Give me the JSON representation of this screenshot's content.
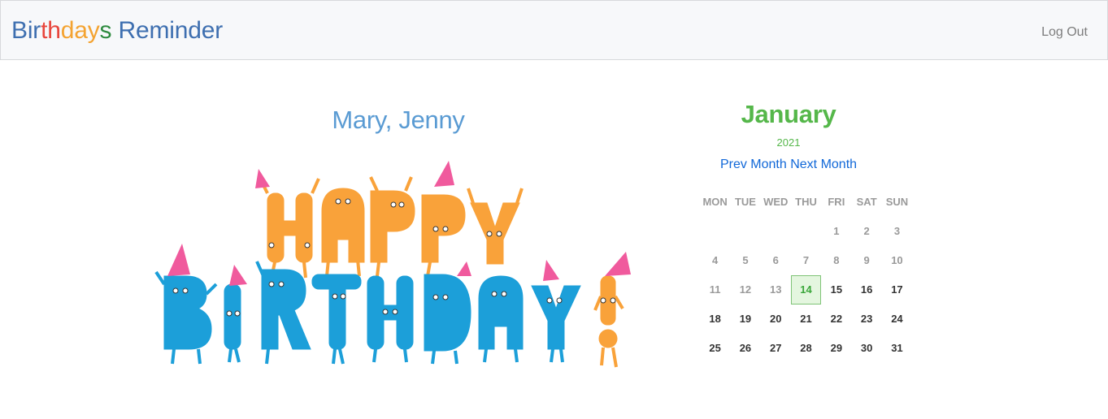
{
  "app": {
    "brand_letters": [
      {
        "ch": "B",
        "color": "#3e6fb0"
      },
      {
        "ch": "i",
        "color": "#3e6fb0"
      },
      {
        "ch": "r",
        "color": "#3e6fb0"
      },
      {
        "ch": "t",
        "color": "#e8453c"
      },
      {
        "ch": "h",
        "color": "#e8453c"
      },
      {
        "ch": "d",
        "color": "#f4a331"
      },
      {
        "ch": "a",
        "color": "#f4a331"
      },
      {
        "ch": "y",
        "color": "#f4a331"
      },
      {
        "ch": "s",
        "color": "#2d8a3e"
      },
      {
        "ch": " ",
        "color": "#3e6fb0"
      },
      {
        "ch": "R",
        "color": "#3e6fb0"
      },
      {
        "ch": "e",
        "color": "#3e6fb0"
      },
      {
        "ch": "m",
        "color": "#3e6fb0"
      },
      {
        "ch": "i",
        "color": "#3e6fb0"
      },
      {
        "ch": "n",
        "color": "#3e6fb0"
      },
      {
        "ch": "d",
        "color": "#3e6fb0"
      },
      {
        "ch": "e",
        "color": "#3e6fb0"
      },
      {
        "ch": "r",
        "color": "#3e6fb0"
      }
    ],
    "logout_label": "Log Out"
  },
  "birthday": {
    "names": "Mary, Jenny",
    "image_icon": "happy-birthday-illustration",
    "image_text": "HAPPY BIRTHDAY!"
  },
  "calendar": {
    "month": "January",
    "year": "2021",
    "prev_label": "Prev Month",
    "next_label": "Next Month",
    "weekdays": [
      "MON",
      "TUE",
      "WED",
      "THU",
      "FRI",
      "SAT",
      "SUN"
    ],
    "leading_blanks": 4,
    "days_in_month": 31,
    "today": 14,
    "colors": {
      "accent_green": "#55b74a",
      "link_blue": "#1168d8",
      "muted": "#9a9a9a"
    }
  }
}
